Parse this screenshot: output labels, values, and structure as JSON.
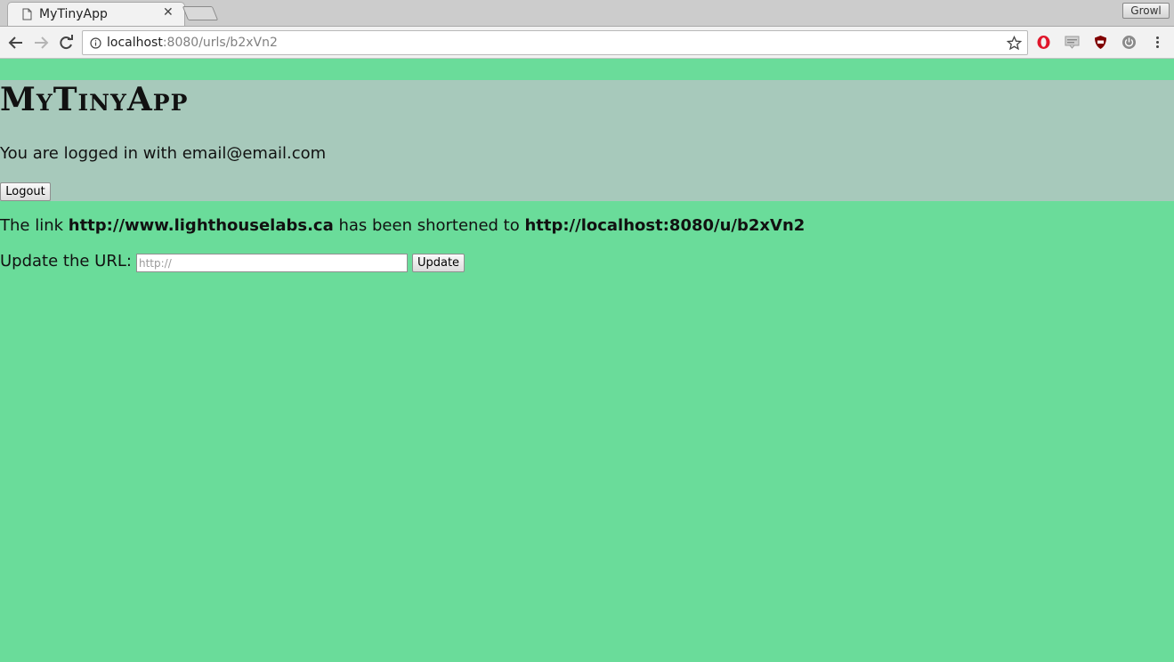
{
  "browser": {
    "tab_title": "MyTinyApp",
    "profile_label": "Growl",
    "url_host": "localhost",
    "url_rest": ":8080/urls/b2xVn2"
  },
  "header": {
    "brand": "MyTinyApp",
    "login_prefix": "You are logged in with ",
    "login_email": "email@email.com",
    "logout_label": "Logout"
  },
  "main": {
    "link_prefix": "The link ",
    "long_url": "http://www.lighthouselabs.ca",
    "link_middle": " has been shortened to ",
    "short_url": "http://localhost:8080/u/b2xVn2",
    "update_label": "Update the URL: ",
    "input_placeholder": "http://",
    "update_button": "Update"
  },
  "colors": {
    "page_background": "#6adc9a",
    "header_background": "#a7c9bb"
  }
}
